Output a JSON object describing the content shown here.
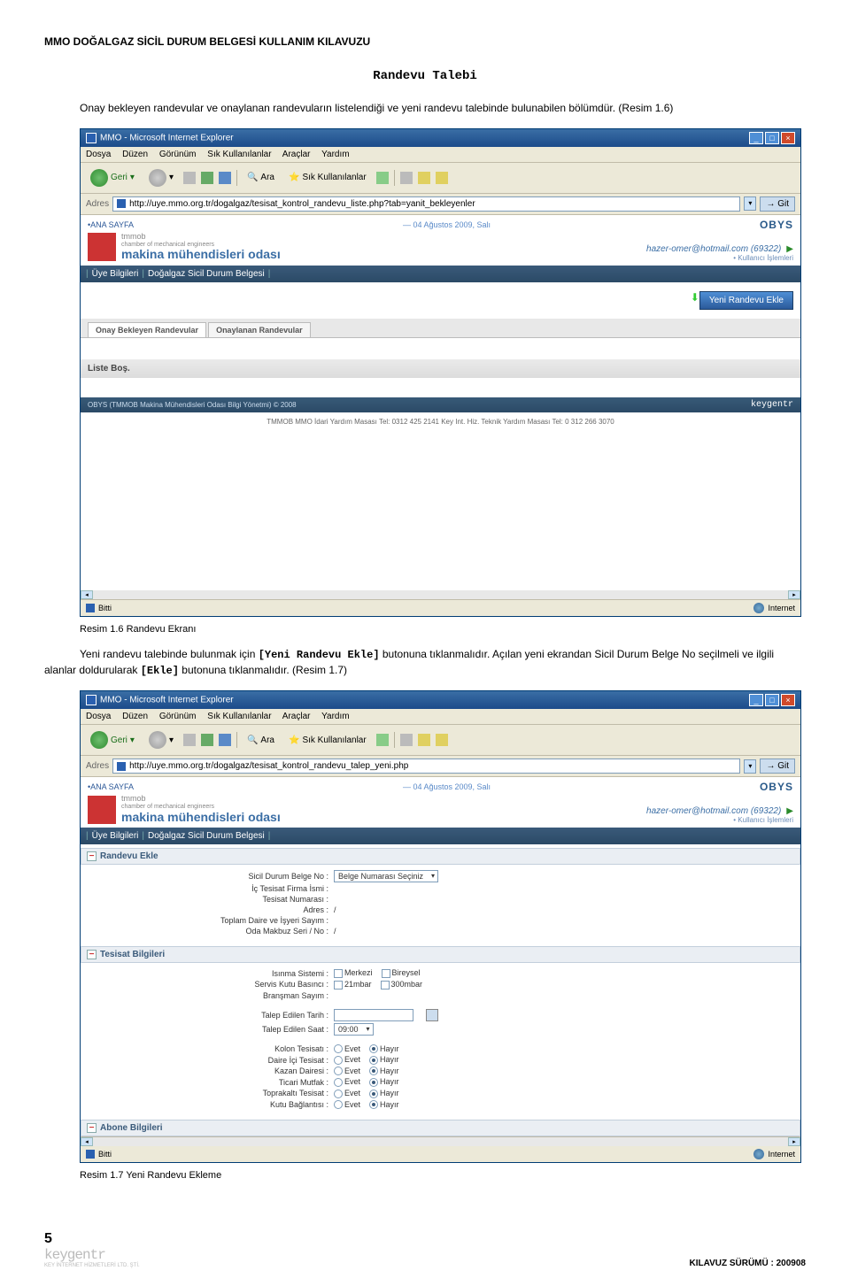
{
  "doc": {
    "header": "MMO DOĞALGAZ SİCİL DURUM BELGESİ KULLANIM KILAVUZU",
    "section_title": "Randevu Talebi",
    "intro": "Onay bekleyen randevular ve onaylanan randevuların listelendiği ve yeni randevu talebinde bulunabilen bölümdür. (Resim 1.6)",
    "caption1": "Resim 1.6 Randevu Ekranı",
    "para2a": "Yeni randevu talebinde bulunmak için ",
    "para2b": " butonuna tıklanmalıdır. Açılan yeni ekrandan Sicil Durum Belge No seçilmeli ve ilgili alanlar doldurularak ",
    "para2c": " butonuna tıklanmalıdır. (Resim 1.7)",
    "code1": "[Yeni Randevu Ekle]",
    "code2": "[Ekle]",
    "caption2": "Resim 1.7 Yeni Randevu Ekleme"
  },
  "browser": {
    "title": "MMO - Microsoft Internet Explorer",
    "menu": [
      "Dosya",
      "Düzen",
      "Görünüm",
      "Sık Kullanılanlar",
      "Araçlar",
      "Yardım"
    ],
    "back": "Geri",
    "search": "Ara",
    "fav": "Sık Kullanılanlar",
    "addr_label": "Adres",
    "url1": "http://uye.mmo.org.tr/dogalgaz/tesisat_kontrol_randevu_liste.php?tab=yanit_bekleyenler",
    "url2": "http://uye.mmo.org.tr/dogalgaz/tesisat_kontrol_randevu_talep_yeni.php",
    "go": "Git",
    "done": "Bitti",
    "internet": "Internet"
  },
  "obys": {
    "home": "•ANA SAYFA",
    "date": "— 04 Ağustos 2009, Salı",
    "badge": "OBYS",
    "logo_top": "tmmob",
    "logo_sub": "chamber of mechanical engineers",
    "logo_main": "makina mühendisleri odası",
    "user": "hazer-omer@hotmail.com (69322)",
    "user_sub": "• Kullanıcı İşlemleri",
    "nav1": "Üye Bilgileri",
    "nav2": "Doğalgaz Sicil Durum Belgesi",
    "new_btn": "Yeni Randevu Ekle",
    "tab1": "Onay Bekleyen Randevular",
    "tab2": "Onaylanan Randevular",
    "empty": "Liste Boş.",
    "copy": "OBYS (TMMOB Makina Mühendisleri Odası Bilgi Yönetmi) © 2008",
    "kg": "keygentr",
    "support": "TMMOB MMO İdari Yardım Masası Tel: 0312 425 2141     Key Int. Hiz. Teknik Yardım Masası Tel: 0 312 266 3070"
  },
  "form": {
    "head1": "Randevu Ekle",
    "head2": "Tesisat Bilgileri",
    "head3": "Abone Bilgileri",
    "f_belge": "Sicil Durum Belge No :",
    "f_belge_sel": "Belge Numarası Seçiniz",
    "f_firma": "İç Tesisat Firma İsmi :",
    "f_tesno": "Tesisat Numarası :",
    "f_adres": "Adres :",
    "f_adres_v": "/",
    "f_sayim": "Toplam Daire ve İşyeri Sayım :",
    "f_oda": "Oda Makbuz Seri / No :",
    "f_oda_v": "/",
    "f_isinma": "Isınma Sistemi :",
    "f_merkezi": "Merkezi",
    "f_bireysel": "Bireysel",
    "f_basinc": "Servis Kutu Basıncı :",
    "f_21": "21mbar",
    "f_300": "300mbar",
    "f_brans": "Branşman Sayım :",
    "f_tarih": "Talep Edilen Tarih :",
    "f_saat": "Talep Edilen Saat :",
    "f_saat_v": "09:00",
    "f_kolon": "Kolon Tesisatı :",
    "f_daire": "Daire İçi Tesisat :",
    "f_kazan": "Kazan Dairesi :",
    "f_mutfak": "Ticari Mutfak :",
    "f_toprak": "Toprakaltı Tesisat :",
    "f_kutu": "Kutu Bağlantısı :",
    "r_evet": "Evet",
    "r_hayir": "Hayır"
  },
  "footer": {
    "page": "5",
    "logo": "keygentr",
    "sub": "KEY İNTERNET HİZMETLERİ LTD. ŞTİ.",
    "version": "KILAVUZ SÜRÜMÜ : 200908"
  }
}
